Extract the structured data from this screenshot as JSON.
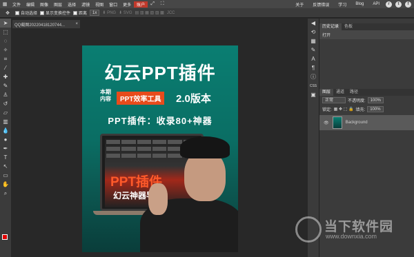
{
  "menu": {
    "items": [
      "文件",
      "编辑",
      "图像",
      "图层",
      "选择",
      "滤镜",
      "视图",
      "窗口",
      "更多"
    ],
    "active": "账户",
    "right": [
      "关于",
      "反馈错误",
      "学习",
      "Blog",
      "API"
    ]
  },
  "options": {
    "auto_select": "自动选择",
    "show_transform": "显示变换控件",
    "distance": "距离",
    "zoom": "1x",
    "png": "PNG",
    "svg": "SVG",
    "jcc": "JCC"
  },
  "doc_tab": {
    "title": "QQ截图20220418120744...",
    "close": "×"
  },
  "poster": {
    "title": "幻云PPT插件",
    "issue": "本期内容",
    "tag": "PPT效率工具",
    "version": "2.0版本",
    "subtitle": "PPT插件：收录80+神器",
    "laptop_big": "PPT插件",
    "laptop_small": "幻云神器导航"
  },
  "panel_top": {
    "tabs": [
      "历史记录",
      "色板"
    ],
    "item": "打开"
  },
  "panel_layers": {
    "tabs": [
      "图层",
      "通道",
      "路径"
    ],
    "blend": "正常",
    "opacity_label": "不透明度:",
    "opacity": "100%",
    "lock_label": "锁定:",
    "fill_label": "填充:",
    "fill": "100%",
    "layer_name": "Background"
  },
  "watermark": {
    "text": "当下软件园",
    "url": "www.downxia.com"
  },
  "colors": {
    "foreground": "#e00000",
    "background": "#000000",
    "accent": "#c0392b"
  }
}
